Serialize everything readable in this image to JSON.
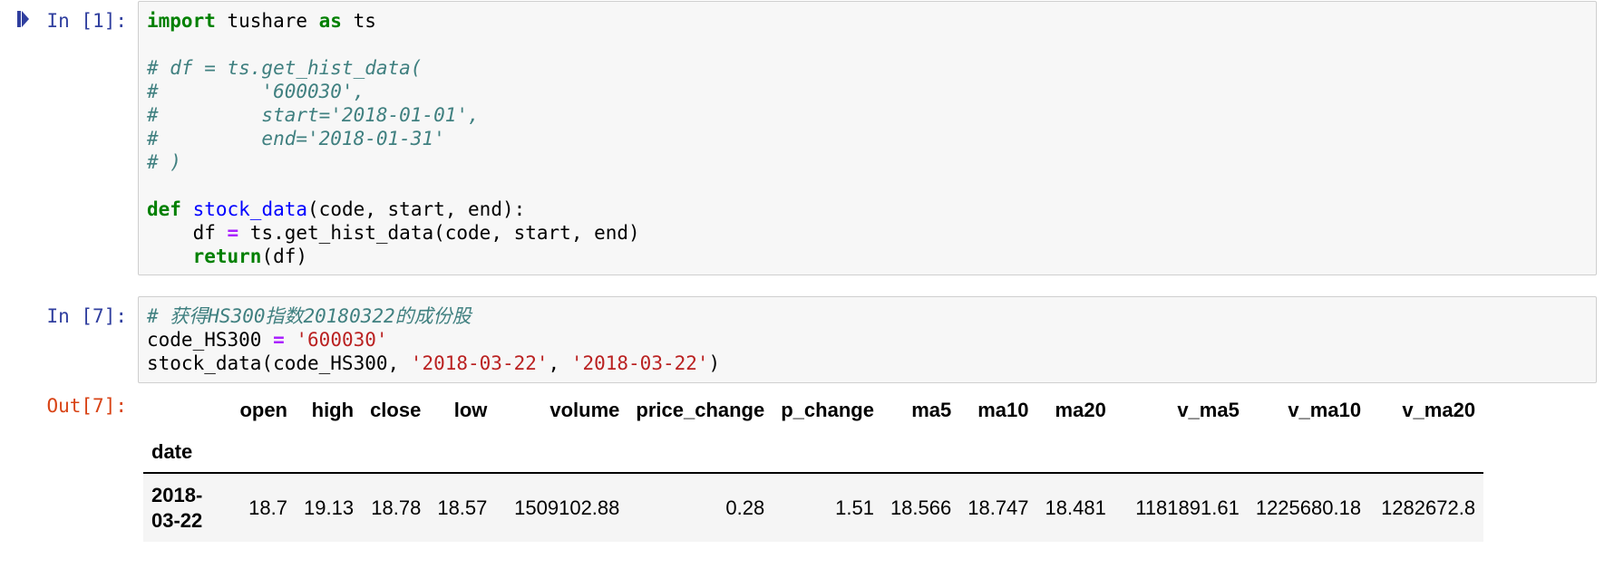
{
  "cells": [
    {
      "prompt": "In [1]:",
      "lines": [
        [
          {
            "t": "import",
            "c": "kw"
          },
          {
            "t": " tushare ",
            "c": ""
          },
          {
            "t": "as",
            "c": "kw"
          },
          {
            "t": " ts",
            "c": ""
          }
        ],
        [],
        [
          {
            "t": "# df = ts.get_hist_data(",
            "c": "cm"
          }
        ],
        [
          {
            "t": "#         '600030',",
            "c": "cm"
          }
        ],
        [
          {
            "t": "#         start='2018-01-01',",
            "c": "cm"
          }
        ],
        [
          {
            "t": "#         end='2018-01-31'",
            "c": "cm"
          }
        ],
        [
          {
            "t": "# )",
            "c": "cm"
          }
        ],
        [],
        [
          {
            "t": "def",
            "c": "kw"
          },
          {
            "t": " ",
            "c": ""
          },
          {
            "t": "stock_data",
            "c": "fn"
          },
          {
            "t": "(code, start, end):",
            "c": ""
          }
        ],
        [
          {
            "t": "    df ",
            "c": ""
          },
          {
            "t": "=",
            "c": "op"
          },
          {
            "t": " ts.get_hist_data(code, start, end)",
            "c": ""
          }
        ],
        [
          {
            "t": "    ",
            "c": ""
          },
          {
            "t": "return",
            "c": "kw"
          },
          {
            "t": "(df)",
            "c": ""
          }
        ]
      ]
    },
    {
      "prompt": "In [7]:",
      "lines": [
        [
          {
            "t": "# 获得HS300指数20180322的成份股",
            "c": "cm"
          }
        ],
        [
          {
            "t": "code_HS300 ",
            "c": ""
          },
          {
            "t": "=",
            "c": "op"
          },
          {
            "t": " ",
            "c": ""
          },
          {
            "t": "'600030'",
            "c": "str"
          }
        ],
        [
          {
            "t": "stock_data(code_HS300, ",
            "c": ""
          },
          {
            "t": "'2018-03-22'",
            "c": "str"
          },
          {
            "t": ", ",
            "c": ""
          },
          {
            "t": "'2018-03-22'",
            "c": "str"
          },
          {
            "t": ")",
            "c": ""
          }
        ]
      ]
    }
  ],
  "output": {
    "prompt": "Out[7]:",
    "index_name": "date",
    "columns": [
      "open",
      "high",
      "close",
      "low",
      "volume",
      "price_change",
      "p_change",
      "ma5",
      "ma10",
      "ma20",
      "v_ma5",
      "v_ma10",
      "v_ma20"
    ],
    "rows": [
      {
        "index": "2018-\n03-22",
        "values": [
          "18.7",
          "19.13",
          "18.78",
          "18.57",
          "1509102.88",
          "0.28",
          "1.51",
          "18.566",
          "18.747",
          "18.481",
          "1181891.61",
          "1225680.18",
          "1282672.8"
        ]
      }
    ]
  }
}
